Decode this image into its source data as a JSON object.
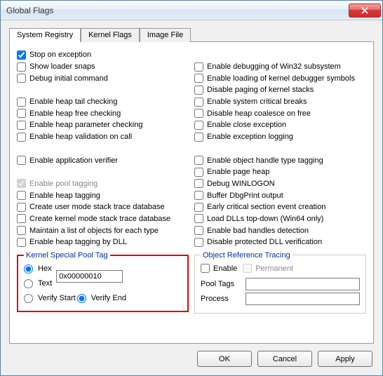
{
  "window": {
    "title": "Global Flags"
  },
  "tabs": {
    "t0": "System Registry",
    "t1": "Kernel Flags",
    "t2": "Image File"
  },
  "left": {
    "c0": "Stop on exception",
    "c1": "Show loader snaps",
    "c2": "Debug initial command",
    "c3": "Enable heap tail checking",
    "c4": "Enable heap free checking",
    "c5": "Enable heap parameter checking",
    "c6": "Enable heap validation on call",
    "c7": "Enable application verifier",
    "c8": "Enable pool tagging",
    "c9": "Enable heap tagging",
    "c10": "Create user mode stack trace database",
    "c11": "Create kernel mode stack trace database",
    "c12": "Maintain a list of objects for each type",
    "c13": "Enable heap tagging by DLL"
  },
  "right": {
    "c0": "Enable debugging of Win32 subsystem",
    "c1": "Enable loading of kernel debugger symbols",
    "c2": "Disable paging of kernel stacks",
    "c3": "Enable system critical breaks",
    "c4": "Disable heap coalesce on free",
    "c5": "Enable close exception",
    "c6": "Enable exception logging",
    "c7": "Enable object handle type tagging",
    "c8": "Enable page heap",
    "c9": "Debug WINLOGON",
    "c10": "Buffer DbgPrint output",
    "c11": "Early critical section event creation",
    "c12": "Load DLLs top-down (Win64 only)",
    "c13": "Enable bad handles detection",
    "c14": "Disable protected DLL verification"
  },
  "pool": {
    "legend": "Kernel Special Pool Tag",
    "hex": "Hex",
    "text": "Text",
    "value": "0x00000010",
    "verify_start": "Verify Start",
    "verify_end": "Verify End"
  },
  "ort": {
    "legend": "Object Reference Tracing",
    "enable": "Enable",
    "permanent": "Permanent",
    "pooltags_label": "Pool Tags",
    "process_label": "Process",
    "pooltags_value": "",
    "process_value": ""
  },
  "buttons": {
    "ok": "OK",
    "cancel": "Cancel",
    "apply": "Apply"
  }
}
